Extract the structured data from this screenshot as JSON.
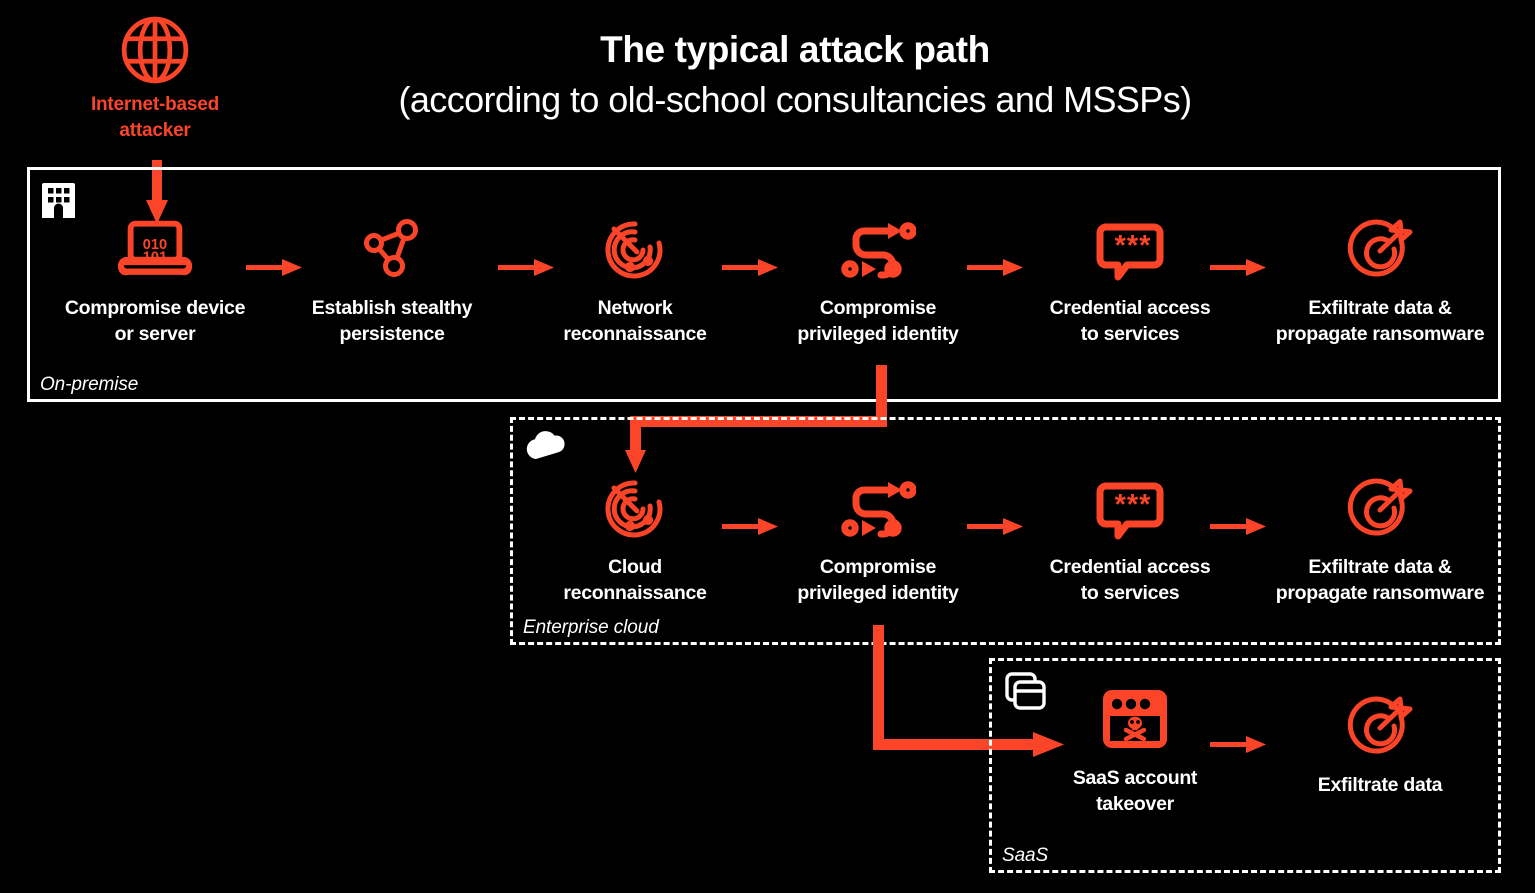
{
  "title": {
    "main": "The typical attack path",
    "sub": "(according to old-school consultancies and MSSPs)"
  },
  "colors": {
    "accent": "#FB4428",
    "background": "#000000",
    "text": "#FFFFFF"
  },
  "attacker": {
    "icon": "globe-icon",
    "label": "Internet-based\nattacker"
  },
  "zones": [
    {
      "id": "on-premise",
      "caption": "On-premise",
      "badge_icon": "building-icon",
      "border": "solid",
      "steps": [
        {
          "icon": "laptop-binary-icon",
          "label": "Compromise device\nor server"
        },
        {
          "icon": "network-nodes-icon",
          "label": "Establish stealthy\npersistence"
        },
        {
          "icon": "radar-icon",
          "label": "Network\nreconnaissance"
        },
        {
          "icon": "path-route-icon",
          "label": "Compromise\nprivileged identity"
        },
        {
          "icon": "password-bubble-icon",
          "label": "Credential access\nto services"
        },
        {
          "icon": "target-arrow-icon",
          "label": "Exfiltrate data &\npropagate ransomware"
        }
      ]
    },
    {
      "id": "enterprise-cloud",
      "caption": "Enterprise cloud",
      "badge_icon": "cloud-icon",
      "border": "dashed",
      "steps": [
        {
          "icon": "radar-icon",
          "label": "Cloud\nreconnaissance"
        },
        {
          "icon": "path-route-icon",
          "label": "Compromise\nprivileged identity"
        },
        {
          "icon": "password-bubble-icon",
          "label": "Credential access\nto services"
        },
        {
          "icon": "target-arrow-icon",
          "label": "Exfiltrate data &\npropagate ransomware"
        }
      ]
    },
    {
      "id": "saas",
      "caption": "SaaS",
      "badge_icon": "windows-stack-icon",
      "border": "dashed",
      "steps": [
        {
          "icon": "browser-skull-icon",
          "label": "SaaS account\ntakeover"
        },
        {
          "icon": "target-arrow-icon",
          "label": "Exfiltrate data"
        }
      ]
    }
  ],
  "connectors": [
    {
      "name": "attacker-to-onprem",
      "from": "internet-attacker",
      "to": "compromise-device"
    },
    {
      "name": "onprem-to-cloud",
      "from": "compromise-privileged-identity-onprem",
      "to": "cloud-reconnaissance"
    },
    {
      "name": "cloud-to-saas",
      "from": "compromise-privileged-identity-cloud",
      "to": "saas-account-takeover"
    }
  ]
}
